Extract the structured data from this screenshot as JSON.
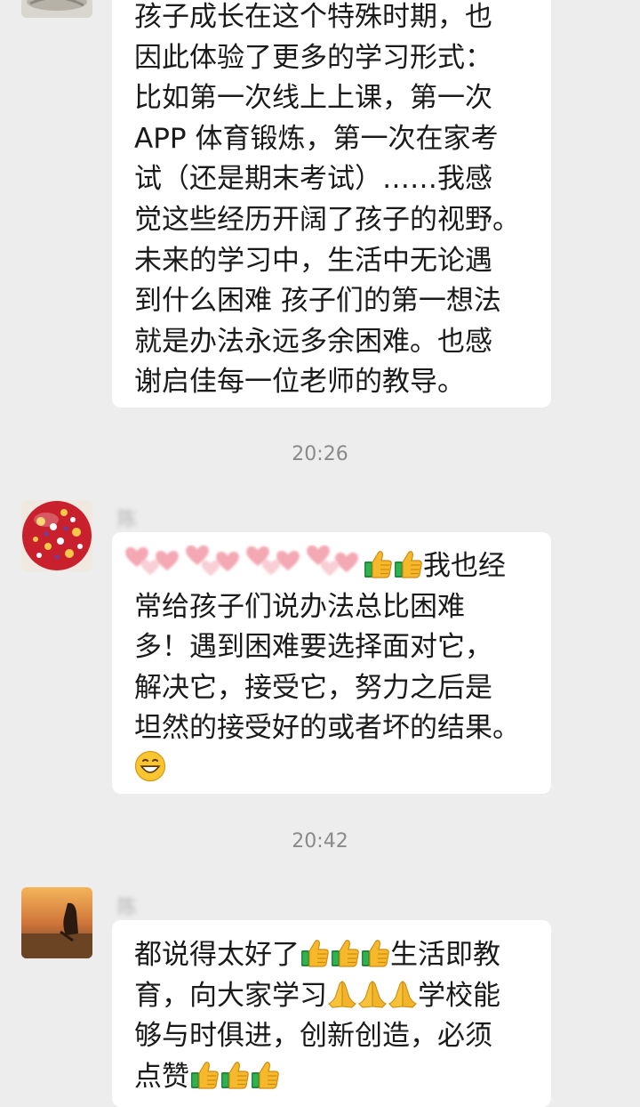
{
  "messages": [
    {
      "lines": [
        "孩子成长在这个特殊时期，也",
        "因此体验了更多的学习形式：",
        "比如第一次线上上课，第一次",
        "APP 体育锻炼，第一次在家考",
        "试（还是期末考试）……我感",
        "觉这些经历开阔了孩子的视野。",
        "未来的学习中，生活中无论遇",
        "到什么困难 孩子们的第一想法",
        "就是办法永远多余困难。也感",
        "谢启佳每一位老师的教导。"
      ]
    },
    {
      "sender": "陈",
      "line1_text": "我也经",
      "lines": [
        "常给孩子们说办法总比困难",
        "多！遇到困难要选择面对它，",
        "解决它，接受它，努力之后是",
        "坦然的接受好的或者坏的结果。"
      ],
      "icons": [
        "hearts-sticker",
        "thumbs-up-icon",
        "grin-emoji-icon"
      ]
    },
    {
      "sender": "陈",
      "line1": "都说得太好了",
      "line1_tail": "生活即教",
      "line2": "育，向大家学习",
      "line2_tail": "学校能",
      "line3": "够与时俱进，创新创造，必须",
      "line4": "点赞",
      "icons": [
        "thumbs-up-icon",
        "praying-hands-icon"
      ]
    }
  ],
  "timestamps": [
    "20:26",
    "20:42"
  ],
  "colors": {
    "background": "#ededed",
    "bubble": "#ffffff",
    "text": "#1a1a1a",
    "timestamp": "#8a8a8a",
    "name": "#b3b3b3"
  }
}
